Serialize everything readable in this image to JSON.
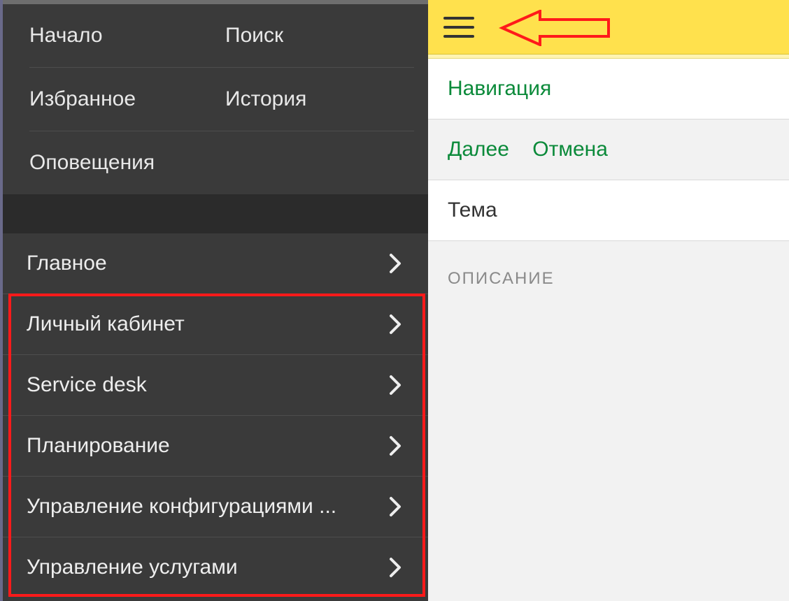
{
  "drawer": {
    "topLinks": {
      "start": "Начало",
      "search": "Поиск",
      "favorites": "Избранное",
      "history": "История",
      "notifications": "Оповещения"
    },
    "nav": [
      {
        "label": "Главное"
      },
      {
        "label": "Личный кабинет"
      },
      {
        "label": "Service desk"
      },
      {
        "label": "Планирование"
      },
      {
        "label": "Управление конфигурациями ..."
      },
      {
        "label": "Управление услугами"
      }
    ]
  },
  "main": {
    "navigation": "Навигация",
    "next": "Далее",
    "cancel": "Отмена",
    "theme": "Тема",
    "descriptionLabel": "ОПИСАНИЕ"
  }
}
